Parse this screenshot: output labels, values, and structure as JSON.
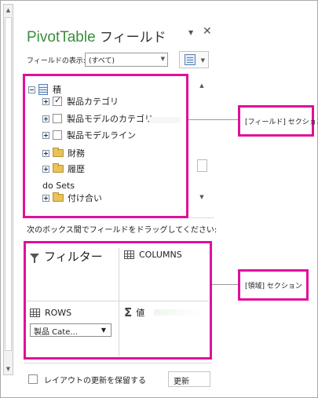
{
  "header": {
    "title_en": "PivotTable",
    "title_jp": "フィールド",
    "dropdown_icon": "chevron-down-icon",
    "close_icon": "close-icon"
  },
  "fields_show": {
    "label": "フィールドの表示:",
    "selected": "(すべて)"
  },
  "field_list": {
    "table_name": "積",
    "items": [
      {
        "label": "製品カテゴリ",
        "checked": true
      },
      {
        "label": "製品モデルのカテゴリ",
        "checked": false
      },
      {
        "label": "製品モデルライン",
        "checked": false
      }
    ],
    "folders": [
      "財務",
      "履歴"
    ],
    "sets_label": "do Sets",
    "sets_folder": "付け合い"
  },
  "drag_hint": "次のボックス間でフィールドをドラッグしてください:",
  "areas": {
    "filters": "フィルター",
    "columns": "COLUMNS",
    "rows": "ROWS",
    "values": "値",
    "rows_field": "製品 Cate..."
  },
  "bottom": {
    "defer_label": "レイアウトの更新を保留する",
    "update_button": "更新"
  },
  "annotations": {
    "fields_callout": "[フィールド] セクション",
    "areas_callout": "[領域] セクション"
  },
  "colors": {
    "highlight": "#e0109a",
    "title_green": "#3a8f3a"
  }
}
